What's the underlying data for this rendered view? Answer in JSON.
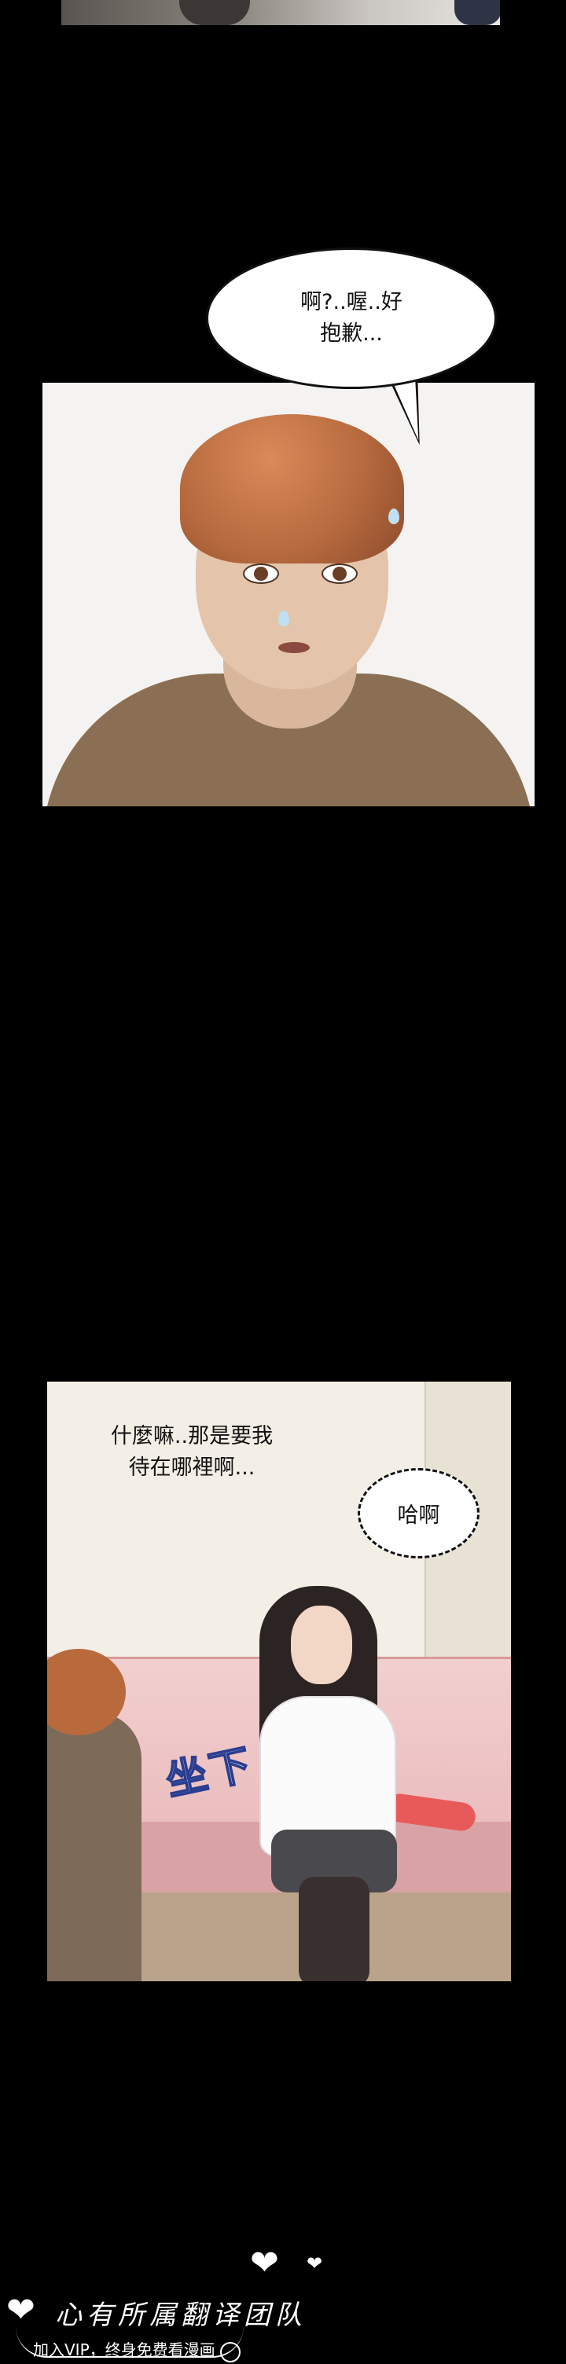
{
  "comic": {
    "bubble1_lines": [
      "啊?..喔..好",
      "抱歉..."
    ],
    "panel2_caption_lines": [
      "什麼嘛..那是要我",
      "待在哪裡啊..."
    ],
    "bubble2_text": "哈啊",
    "sfx_text": "坐下"
  },
  "footer": {
    "brand": "心有所属翻译团队",
    "tagline": "加入VIP，终身免费看漫画"
  }
}
